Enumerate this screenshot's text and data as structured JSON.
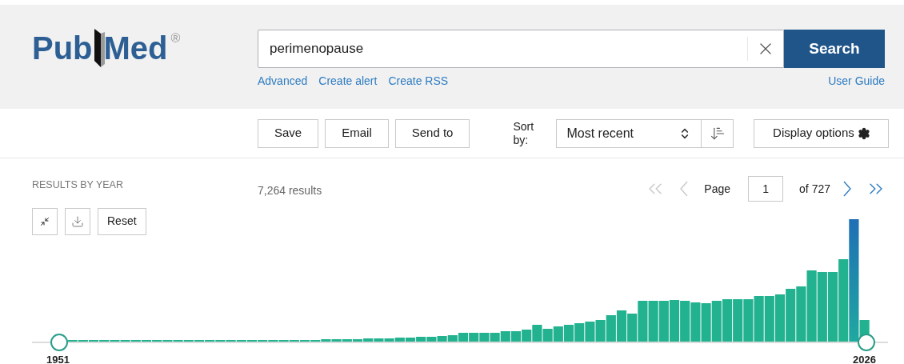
{
  "logo": {
    "first": "Pub",
    "second": "Med",
    "mark": "®"
  },
  "search": {
    "value": "perimenopause",
    "button": "Search"
  },
  "search_links": [
    "Advanced",
    "Create alert",
    "Create RSS"
  ],
  "user_guide": "User Guide",
  "toolbar": {
    "buttons": [
      "Save",
      "Email",
      "Send to"
    ],
    "sort_label": "Sort by:",
    "sort_value": "Most recent",
    "display_options": "Display options"
  },
  "results_by_year": {
    "title": "RESULTS BY YEAR",
    "reset": "Reset",
    "start_year": "1951",
    "end_year": "2026"
  },
  "result_count": "7,264 results",
  "pagination": {
    "first": {
      "disabled": true
    },
    "previous": {
      "disabled": true
    },
    "page_label": "Page",
    "page": "1",
    "of_label": "of 727",
    "next": {
      "disabled": false
    },
    "last": {
      "disabled": false
    }
  }
}
